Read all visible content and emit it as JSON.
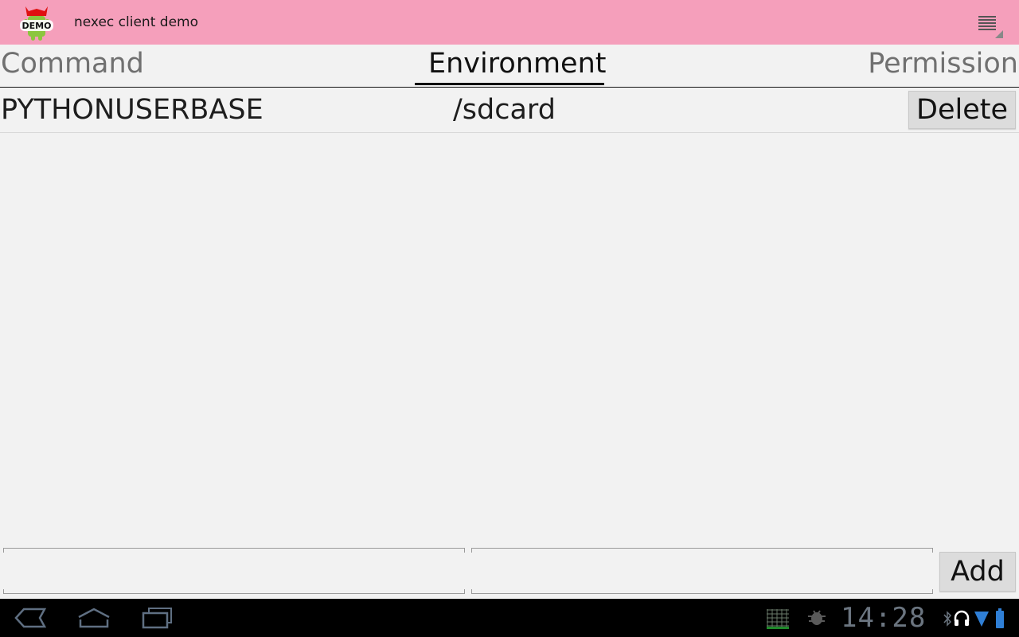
{
  "app_bar": {
    "icon": "demo-android-icon",
    "icon_text": "DEMO",
    "title": "nexec client demo",
    "overflow_icon": "overflow-menu-icon",
    "color": "#f59fbb"
  },
  "tabs": [
    {
      "label": "Command",
      "selected": false
    },
    {
      "label": "Environment",
      "selected": true
    },
    {
      "label": "Permission",
      "selected": false
    }
  ],
  "env_list": [
    {
      "name": "PYTHONUSERBASE",
      "value": "/sdcard",
      "delete_label": "Delete"
    }
  ],
  "add_row": {
    "name_value": "",
    "value_value": "",
    "add_label": "Add"
  },
  "system_bar": {
    "nav_icons": [
      "back-icon",
      "home-icon",
      "recent-apps-icon"
    ],
    "status_icons": [
      "keyboard-icon",
      "android-debug-icon",
      "bluetooth-icon",
      "headset-icon",
      "wifi-icon",
      "battery-icon"
    ],
    "time": "14:28"
  }
}
